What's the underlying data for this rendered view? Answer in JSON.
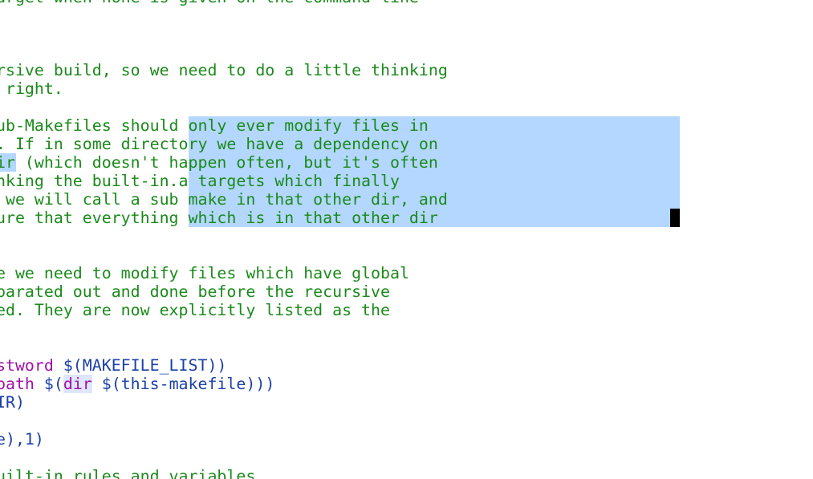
{
  "editor": {
    "comment_lines": [
      "arget when none is given on the command line",
      "",
      "",
      "rsive build, so we need to do a little thinking",
      " right.",
      "",
      "ub-Makefiles should only ever modify files in",
      ". If in some directory we have a dependency on",
      "ir (which doesn't happen often, but it's often",
      "nking the built-in.a targets which finally",
      " we will call a sub make in that other dir, and",
      "ure that everything which is in that other dir",
      "",
      "",
      "e we need to modify files which have global",
      "parated out and done before the recursive",
      "ed. They are now explicitly listed as the"
    ],
    "code": {
      "line1_kw": "stword",
      "line1_rest": " $(MAKEFILE_LIST))",
      "line2_kw": "path",
      "line2_mid": " $(",
      "line2_kw2": "dir",
      "line2_rest": " $(this-makefile)))",
      "line3": "IR)",
      "line5": "e),1)"
    },
    "bottom_comment": "uilt-in rules and variables"
  }
}
